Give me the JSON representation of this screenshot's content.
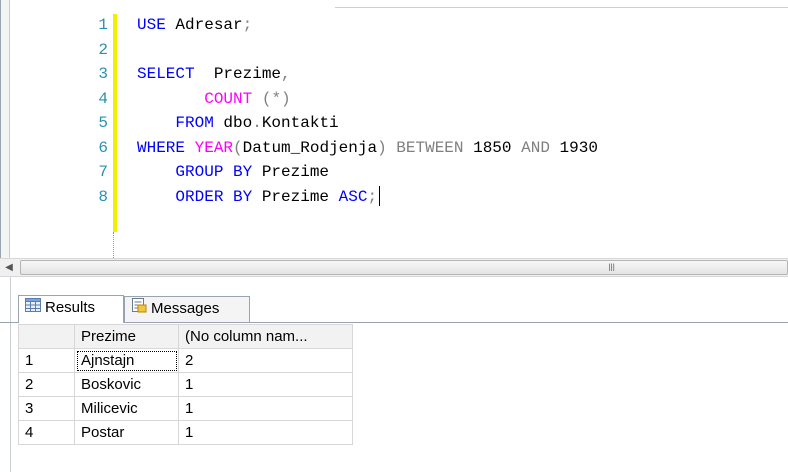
{
  "editor": {
    "lines": [
      {
        "n": "1",
        "html": "<span class=\"kw\">USE</span> Adresar<span class=\"op\">;</span>"
      },
      {
        "n": "2",
        "html": ""
      },
      {
        "n": "3",
        "html": "<span class=\"kw\">SELECT</span>  Prezime<span class=\"op\">,</span>"
      },
      {
        "n": "4",
        "html": "       <span class=\"fn\">COUNT</span> <span class=\"op\">(*)</span>"
      },
      {
        "n": "5",
        "html": "    <span class=\"kw\">FROM</span> dbo<span class=\"op\">.</span>Kontakti"
      },
      {
        "n": "6",
        "html": "<span class=\"kw\">WHERE</span> <span class=\"fn\">YEAR</span><span class=\"op\">(</span>Datum_Rodjenja<span class=\"op\">)</span> <span class=\"op\">BETWEEN</span> 1850 <span class=\"op\">AND</span> 1930"
      },
      {
        "n": "7",
        "html": "    <span class=\"kw\">GROUP BY</span> Prezime"
      },
      {
        "n": "8",
        "html": "    <span class=\"kw\">ORDER BY</span> Prezime <span class=\"kw\">ASC</span><span class=\"op\">;</span>"
      }
    ]
  },
  "scrollbar": {
    "grip": "III"
  },
  "tabs": {
    "results_label": "Results",
    "messages_label": "Messages"
  },
  "grid": {
    "columns": [
      "Prezime",
      "(No column nam..."
    ],
    "rows": [
      {
        "num": "1",
        "prezime": "Ajnstajn",
        "count": "2"
      },
      {
        "num": "2",
        "prezime": "Boskovic",
        "count": "1"
      },
      {
        "num": "3",
        "prezime": "Milicevic",
        "count": "1"
      },
      {
        "num": "4",
        "prezime": "Postar",
        "count": "1"
      }
    ]
  }
}
